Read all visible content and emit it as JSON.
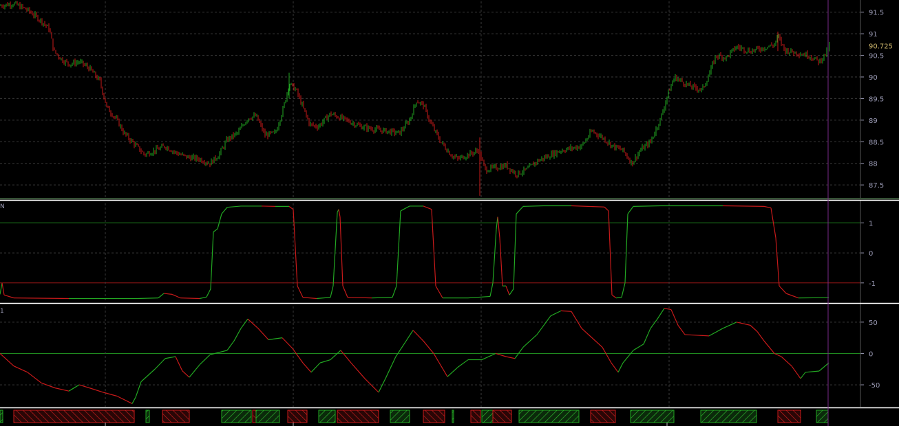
{
  "colors": {
    "background": "#000000",
    "up": "#22a722",
    "down": "#c81a1a",
    "grid": "#3a3a3a",
    "axis_text": "#9a9ab4",
    "separator": "#ffffff",
    "separator_green": "#8fd88f",
    "cursor": "#7a2a8a",
    "level_green": "#1f8a1f",
    "level_red": "#a01818",
    "price_tag": "#c9b26a"
  },
  "chart_data": [
    {
      "type": "candlestick",
      "pane": "price",
      "ylim": [
        87.2,
        91.75
      ],
      "y_ticks": [
        "87.5",
        "88",
        "88.5",
        "89",
        "89.5",
        "90",
        "90.5",
        "91",
        "91.5"
      ],
      "last_price_label": "90.725",
      "grid": "dashed",
      "close_path": [
        [
          0,
          91.65
        ],
        [
          20,
          91.7
        ],
        [
          40,
          91.55
        ],
        [
          60,
          91.3
        ],
        [
          72,
          91.1
        ],
        [
          78,
          90.6
        ],
        [
          90,
          90.4
        ],
        [
          100,
          90.3
        ],
        [
          115,
          90.35
        ],
        [
          130,
          90.2
        ],
        [
          145,
          89.9
        ],
        [
          155,
          89.3
        ],
        [
          170,
          89.0
        ],
        [
          180,
          88.7
        ],
        [
          195,
          88.45
        ],
        [
          210,
          88.2
        ],
        [
          225,
          88.3
        ],
        [
          240,
          88.4
        ],
        [
          255,
          88.25
        ],
        [
          270,
          88.15
        ],
        [
          290,
          88.1
        ],
        [
          305,
          88.0
        ],
        [
          318,
          88.2
        ],
        [
          330,
          88.55
        ],
        [
          345,
          88.7
        ],
        [
          360,
          89.05
        ],
        [
          372,
          89.1
        ],
        [
          385,
          88.65
        ],
        [
          400,
          88.7
        ],
        [
          412,
          89.3
        ],
        [
          420,
          89.85
        ],
        [
          430,
          89.7
        ],
        [
          440,
          89.3
        ],
        [
          450,
          88.9
        ],
        [
          462,
          88.85
        ],
        [
          480,
          89.15
        ],
        [
          495,
          89.05
        ],
        [
          510,
          88.95
        ],
        [
          525,
          88.85
        ],
        [
          540,
          88.8
        ],
        [
          560,
          88.75
        ],
        [
          580,
          88.7
        ],
        [
          595,
          89.0
        ],
        [
          605,
          89.45
        ],
        [
          615,
          89.35
        ],
        [
          625,
          88.95
        ],
        [
          640,
          88.5
        ],
        [
          655,
          88.2
        ],
        [
          665,
          88.1
        ],
        [
          680,
          88.2
        ],
        [
          695,
          88.3
        ],
        [
          705,
          87.85
        ],
        [
          720,
          87.9
        ],
        [
          735,
          87.95
        ],
        [
          750,
          87.75
        ],
        [
          765,
          87.85
        ],
        [
          780,
          88.05
        ],
        [
          800,
          88.2
        ],
        [
          815,
          88.3
        ],
        [
          830,
          88.35
        ],
        [
          845,
          88.4
        ],
        [
          860,
          88.75
        ],
        [
          875,
          88.6
        ],
        [
          890,
          88.4
        ],
        [
          905,
          88.3
        ],
        [
          918,
          88.0
        ],
        [
          930,
          88.3
        ],
        [
          945,
          88.5
        ],
        [
          960,
          89.05
        ],
        [
          970,
          89.6
        ],
        [
          980,
          90.0
        ],
        [
          1000,
          89.8
        ],
        [
          1020,
          89.7
        ],
        [
          1030,
          90.05
        ],
        [
          1040,
          90.5
        ],
        [
          1055,
          90.45
        ],
        [
          1070,
          90.7
        ],
        [
          1090,
          90.6
        ],
        [
          1110,
          90.68
        ],
        [
          1125,
          90.75
        ],
        [
          1130,
          90.95
        ],
        [
          1140,
          90.62
        ],
        [
          1160,
          90.55
        ],
        [
          1175,
          90.5
        ],
        [
          1190,
          90.35
        ],
        [
          1200,
          90.55
        ],
        [
          1205,
          90.72
        ]
      ]
    },
    {
      "type": "line",
      "pane": "oscillator",
      "pane_label": "N",
      "ylim": [
        -1.6,
        1.65
      ],
      "y_ticks": [
        "1",
        "0",
        "-1"
      ],
      "levels": [
        1,
        -1
      ],
      "values": [
        [
          0,
          -1.38
        ],
        [
          3,
          -1.0
        ],
        [
          6,
          -1.4
        ],
        [
          20,
          -1.5
        ],
        [
          100,
          -1.52
        ],
        [
          200,
          -1.52
        ],
        [
          230,
          -1.5
        ],
        [
          238,
          -1.35
        ],
        [
          250,
          -1.38
        ],
        [
          262,
          -1.5
        ],
        [
          290,
          -1.52
        ],
        [
          300,
          -1.47
        ],
        [
          306,
          -1.2
        ],
        [
          310,
          0.7
        ],
        [
          316,
          0.8
        ],
        [
          322,
          1.3
        ],
        [
          330,
          1.52
        ],
        [
          350,
          1.56
        ],
        [
          380,
          1.56
        ],
        [
          400,
          1.55
        ],
        [
          420,
          1.55
        ],
        [
          426,
          1.45
        ],
        [
          432,
          -1.1
        ],
        [
          440,
          -1.48
        ],
        [
          460,
          -1.52
        ],
        [
          480,
          -1.48
        ],
        [
          484,
          -1.1
        ],
        [
          490,
          1.35
        ],
        [
          492,
          1.45
        ],
        [
          494,
          1.2
        ],
        [
          498,
          -1.1
        ],
        [
          505,
          -1.48
        ],
        [
          540,
          -1.5
        ],
        [
          570,
          -1.48
        ],
        [
          576,
          -1.1
        ],
        [
          582,
          1.4
        ],
        [
          595,
          1.56
        ],
        [
          615,
          1.56
        ],
        [
          627,
          1.45
        ],
        [
          633,
          -1.1
        ],
        [
          643,
          -1.5
        ],
        [
          680,
          -1.5
        ],
        [
          712,
          -1.45
        ],
        [
          716,
          -1.0
        ],
        [
          721,
          0.8
        ],
        [
          723,
          1.2
        ],
        [
          726,
          0.5
        ],
        [
          730,
          -1.1
        ],
        [
          735,
          -1.1
        ],
        [
          740,
          -1.4
        ],
        [
          746,
          -1.2
        ],
        [
          750,
          1.3
        ],
        [
          760,
          1.55
        ],
        [
          790,
          1.57
        ],
        [
          830,
          1.57
        ],
        [
          878,
          1.53
        ],
        [
          884,
          1.4
        ],
        [
          889,
          -1.4
        ],
        [
          895,
          -1.5
        ],
        [
          903,
          -1.48
        ],
        [
          908,
          -1.0
        ],
        [
          912,
          1.3
        ],
        [
          920,
          1.55
        ],
        [
          960,
          1.57
        ],
        [
          1050,
          1.57
        ],
        [
          1110,
          1.55
        ],
        [
          1120,
          1.5
        ],
        [
          1127,
          0.5
        ],
        [
          1132,
          -1.1
        ],
        [
          1142,
          -1.35
        ],
        [
          1160,
          -1.5
        ],
        [
          1204,
          -1.49
        ]
      ]
    },
    {
      "type": "line",
      "pane": "momentum",
      "pane_label": "1",
      "ylim": [
        -85,
        75
      ],
      "y_ticks": [
        "50",
        "0",
        "-50"
      ],
      "levels": [
        0
      ],
      "values": [
        [
          0,
          0
        ],
        [
          20,
          -20
        ],
        [
          40,
          -30
        ],
        [
          60,
          -47
        ],
        [
          80,
          -55
        ],
        [
          100,
          -60
        ],
        [
          115,
          -50
        ],
        [
          130,
          -55
        ],
        [
          150,
          -62
        ],
        [
          170,
          -68
        ],
        [
          192,
          -80
        ],
        [
          197,
          -70
        ],
        [
          205,
          -45
        ],
        [
          225,
          -25
        ],
        [
          240,
          -8
        ],
        [
          255,
          -5
        ],
        [
          265,
          -28
        ],
        [
          275,
          -38
        ],
        [
          290,
          -18
        ],
        [
          305,
          -2
        ],
        [
          330,
          5
        ],
        [
          340,
          20
        ],
        [
          350,
          40
        ],
        [
          360,
          55
        ],
        [
          375,
          40
        ],
        [
          390,
          22
        ],
        [
          410,
          25
        ],
        [
          425,
          8
        ],
        [
          440,
          -15
        ],
        [
          452,
          -30
        ],
        [
          465,
          -15
        ],
        [
          480,
          -10
        ],
        [
          495,
          5
        ],
        [
          510,
          -15
        ],
        [
          530,
          -40
        ],
        [
          550,
          -62
        ],
        [
          560,
          -40
        ],
        [
          575,
          -5
        ],
        [
          590,
          20
        ],
        [
          600,
          37
        ],
        [
          615,
          20
        ],
        [
          630,
          0
        ],
        [
          650,
          -37
        ],
        [
          665,
          -22
        ],
        [
          680,
          -10
        ],
        [
          700,
          -10
        ],
        [
          720,
          0
        ],
        [
          735,
          -5
        ],
        [
          748,
          -8
        ],
        [
          760,
          10
        ],
        [
          780,
          30
        ],
        [
          800,
          60
        ],
        [
          815,
          68
        ],
        [
          830,
          67
        ],
        [
          845,
          40
        ],
        [
          860,
          25
        ],
        [
          875,
          10
        ],
        [
          888,
          -15
        ],
        [
          898,
          -30
        ],
        [
          905,
          -15
        ],
        [
          920,
          5
        ],
        [
          935,
          15
        ],
        [
          945,
          40
        ],
        [
          955,
          55
        ],
        [
          965,
          72
        ],
        [
          975,
          70
        ],
        [
          985,
          45
        ],
        [
          995,
          30
        ],
        [
          1030,
          28
        ],
        [
          1050,
          40
        ],
        [
          1070,
          50
        ],
        [
          1090,
          45
        ],
        [
          1100,
          35
        ],
        [
          1110,
          20
        ],
        [
          1125,
          0
        ],
        [
          1135,
          -5
        ],
        [
          1150,
          -20
        ],
        [
          1163,
          -40
        ],
        [
          1170,
          -30
        ],
        [
          1190,
          -28
        ],
        [
          1204,
          -15
        ]
      ]
    },
    {
      "type": "bar",
      "pane": "signal_strip",
      "blocks": [
        {
          "from": 0,
          "to": 4,
          "dir": "up"
        },
        {
          "from": 20,
          "to": 195,
          "dir": "down"
        },
        {
          "from": 212,
          "to": 217,
          "dir": "up"
        },
        {
          "from": 236,
          "to": 275,
          "dir": "down"
        },
        {
          "from": 322,
          "to": 365,
          "dir": "up"
        },
        {
          "from": 367,
          "to": 372,
          "dir": "down"
        },
        {
          "from": 372,
          "to": 406,
          "dir": "up"
        },
        {
          "from": 418,
          "to": 446,
          "dir": "down"
        },
        {
          "from": 463,
          "to": 487,
          "dir": "up"
        },
        {
          "from": 490,
          "to": 550,
          "dir": "down"
        },
        {
          "from": 567,
          "to": 595,
          "dir": "up"
        },
        {
          "from": 615,
          "to": 646,
          "dir": "down"
        },
        {
          "from": 657,
          "to": 659,
          "dir": "up"
        },
        {
          "from": 684,
          "to": 698,
          "dir": "down"
        },
        {
          "from": 700,
          "to": 716,
          "dir": "up"
        },
        {
          "from": 716,
          "to": 743,
          "dir": "down"
        },
        {
          "from": 754,
          "to": 841,
          "dir": "up"
        },
        {
          "from": 858,
          "to": 894,
          "dir": "down"
        },
        {
          "from": 916,
          "to": 979,
          "dir": "up"
        },
        {
          "from": 1018,
          "to": 1099,
          "dir": "up"
        },
        {
          "from": 1130,
          "to": 1163,
          "dir": "down"
        },
        {
          "from": 1186,
          "to": 1203,
          "dir": "up"
        }
      ]
    }
  ]
}
